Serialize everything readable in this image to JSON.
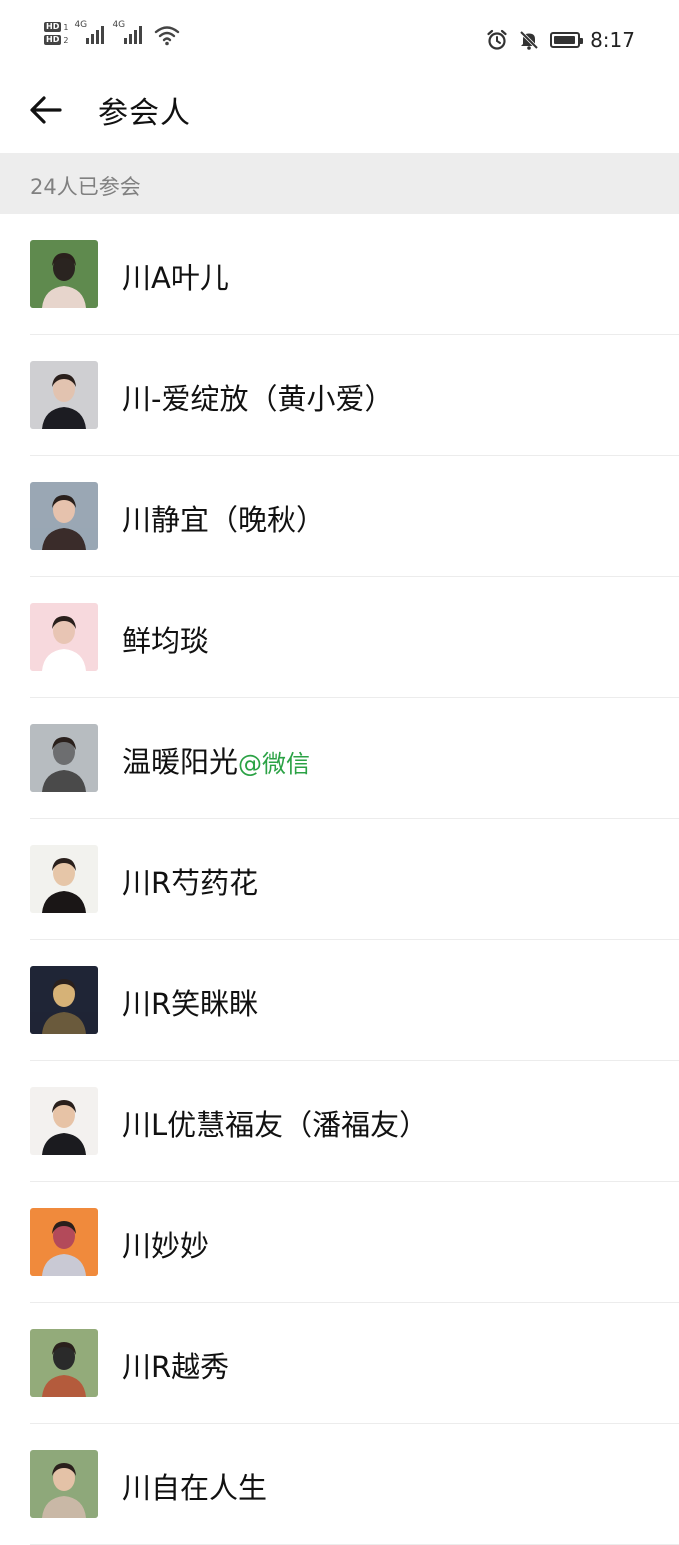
{
  "status_bar": {
    "hd_labels": [
      "HD",
      "HD"
    ],
    "hd_sims": [
      "1",
      "2"
    ],
    "network_labels": [
      "4G",
      "4G"
    ],
    "time": "8:17",
    "icons": [
      "alarm-icon",
      "mute-icon",
      "battery-icon"
    ],
    "battery_level": 0.95
  },
  "header": {
    "title": "参会人",
    "back_icon": "arrow-left-icon"
  },
  "section": {
    "label": "24人已参会"
  },
  "participants": [
    {
      "name": "川A叶儿",
      "suffix": "",
      "avatar_colors": [
        "#5f8a4e",
        "#e7d5cc",
        "#2a2420"
      ]
    },
    {
      "name": "川-爱绽放（黄小爱）",
      "suffix": "",
      "avatar_colors": [
        "#cfcfd2",
        "#1c1c22",
        "#e2c3b0"
      ]
    },
    {
      "name": "川静宜（晚秋）",
      "suffix": "",
      "avatar_colors": [
        "#9aa7b4",
        "#3a2c2a",
        "#e6c2ad"
      ]
    },
    {
      "name": "鲜均琰",
      "suffix": "",
      "avatar_colors": [
        "#f7d9dd",
        "#ffffff",
        "#e8c5b4"
      ]
    },
    {
      "name": "温暖阳光",
      "suffix": "@微信",
      "avatar_colors": [
        "#b7bcc0",
        "#4a4a4a",
        "#6d6e70"
      ]
    },
    {
      "name": "川R芍药花",
      "suffix": "",
      "avatar_colors": [
        "#f2f2ee",
        "#1a1616",
        "#e6c6a8"
      ]
    },
    {
      "name": "川R笑眯眯",
      "suffix": "",
      "avatar_colors": [
        "#1f2536",
        "#6a5a3c",
        "#d6b277"
      ]
    },
    {
      "name": "川L优慧福友（潘福友）",
      "suffix": "",
      "avatar_colors": [
        "#f3f1ef",
        "#1b1b1f",
        "#e7c3a6"
      ]
    },
    {
      "name": "川妙妙",
      "suffix": "",
      "avatar_colors": [
        "#f08a3c",
        "#c9c9d4",
        "#b34a5a"
      ]
    },
    {
      "name": "川R越秀",
      "suffix": "",
      "avatar_colors": [
        "#93ab7a",
        "#b45b3c",
        "#2a2a2a"
      ]
    },
    {
      "name": "川自在人生",
      "suffix": "",
      "avatar_colors": [
        "#8ea87a",
        "#c9b8a6",
        "#e4c2a7"
      ]
    }
  ]
}
